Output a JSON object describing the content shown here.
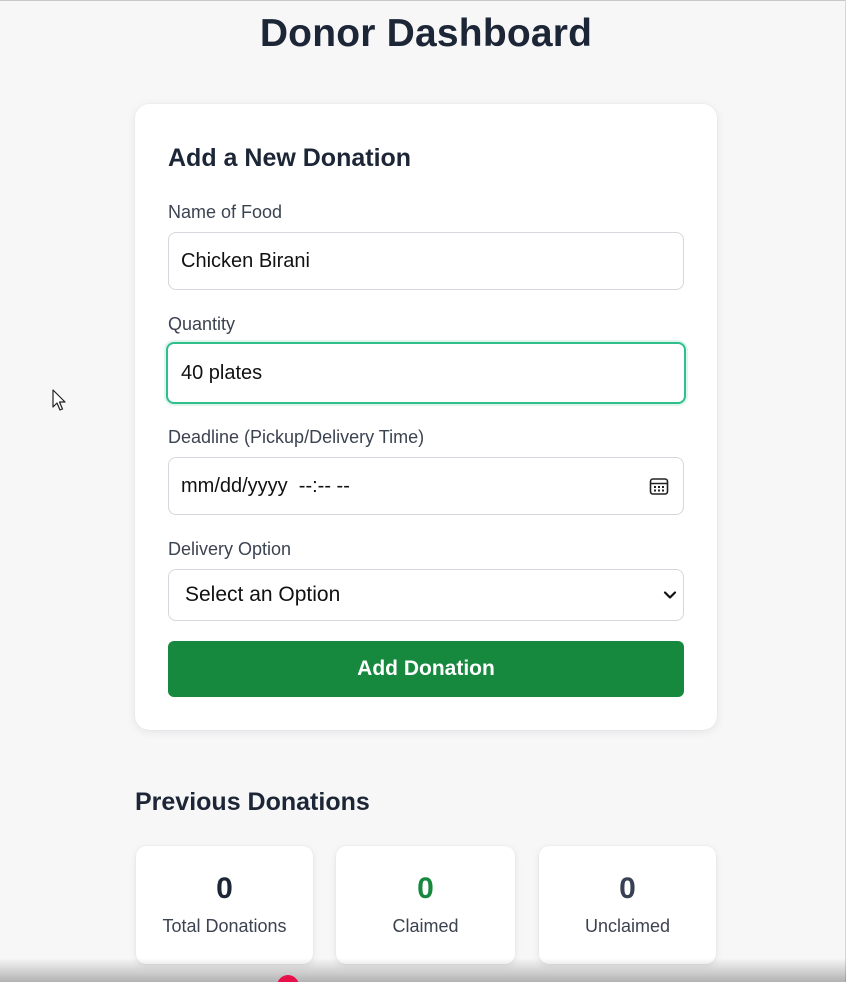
{
  "page": {
    "title": "Donor Dashboard"
  },
  "form": {
    "title": "Add a New Donation",
    "food_name": {
      "label": "Name of Food",
      "value": "Chicken Birani"
    },
    "quantity": {
      "label": "Quantity",
      "value": "40 plates"
    },
    "deadline": {
      "label": "Deadline (Pickup/Delivery Time)",
      "value": "mm/dd/yyyy  --:-- --"
    },
    "delivery": {
      "label": "Delivery Option",
      "selected": "Select an Option"
    },
    "submit_label": "Add Donation"
  },
  "previous": {
    "title": "Previous Donations",
    "stats": [
      {
        "value": "0",
        "label": "Total Donations",
        "color": "#1c2636"
      },
      {
        "value": "0",
        "label": "Claimed",
        "color": "#16893e"
      },
      {
        "value": "0",
        "label": "Unclaimed",
        "color": "#374151"
      }
    ]
  },
  "colors": {
    "accent_green": "#16893e",
    "focus_border": "#2ebf8a",
    "heading": "#1c2636"
  },
  "icons": {
    "calendar": "calendar-icon",
    "chevron": "chevron-down-icon",
    "cursor": "mouse-cursor-icon"
  }
}
